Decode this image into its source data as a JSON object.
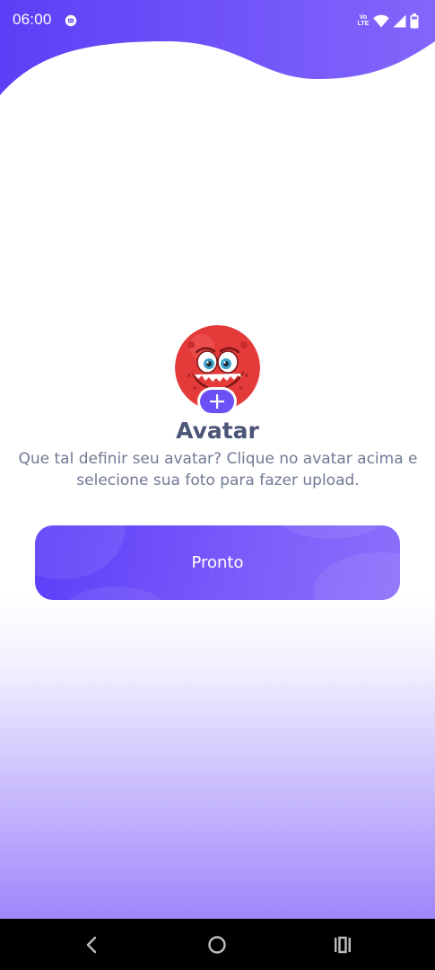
{
  "status_bar": {
    "time": "06:00",
    "network_label_top": "Vo",
    "network_label_bottom": "LTE"
  },
  "onboarding": {
    "title": "Avatar",
    "description": "Que tal definir seu avatar? Clique no avatar acima e selecione sua foto para fazer upload.",
    "done_button_label": "Pronto"
  },
  "colors": {
    "accent": "#6c4ff5",
    "title_text": "#4b5577",
    "body_text": "#717a94",
    "avatar_red": "#e53a3a"
  },
  "icons": {
    "add_badge": "plus-icon",
    "nav_back": "back-icon",
    "nav_home": "home-icon",
    "nav_recents": "recents-icon"
  }
}
